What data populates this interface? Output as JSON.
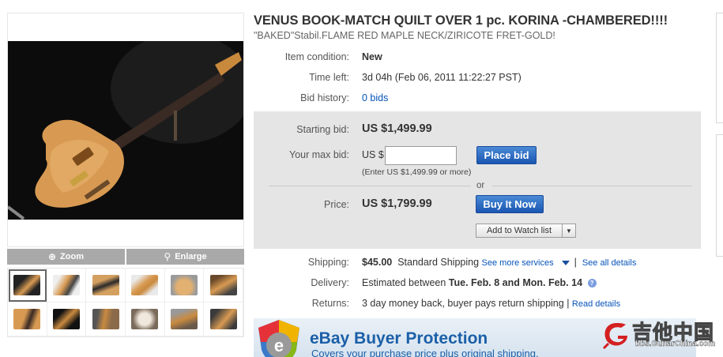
{
  "listing": {
    "title": "VENUS BOOK-MATCH QUILT OVER 1 pc. KORINA -CHAMBERED!!!!",
    "subtitle": "\"BAKED\"Stabil.FLAME RED MAPLE NECK/ZIRICOTE FRET-GOLD!"
  },
  "gallery": {
    "zoom_label": "Zoom",
    "enlarge_label": "Enlarge",
    "zoom_icon": "crosshair-icon",
    "enlarge_icon": "magnifier-icon",
    "thumbnail_count": 12
  },
  "details": {
    "condition_label": "Item condition:",
    "condition_value": "New",
    "time_left_label": "Time left:",
    "time_left_value": "3d 04h",
    "time_left_end": "(Feb 06, 2011 11:22:27 PST)",
    "bid_history_label": "Bid history:",
    "bid_history_value": "0 bids"
  },
  "bidding": {
    "starting_bid_label": "Starting bid:",
    "starting_bid_value": "US $1,499.99",
    "max_bid_label": "Your max bid:",
    "currency_prefix": "US $",
    "max_bid_value": "",
    "place_bid_label": "Place bid",
    "hint": "(Enter US $1,499.99 or more)",
    "or_label": "or",
    "price_label": "Price:",
    "price_value": "US $1,799.99",
    "buy_it_now_label": "Buy It Now",
    "watch_list_label": "Add to Watch list",
    "watch_dropdown_icon": "triangle-down-icon"
  },
  "shipping": {
    "shipping_label": "Shipping:",
    "shipping_cost": "$45.00",
    "shipping_method": "Standard Shipping",
    "more_services": "See more services",
    "separator": "|",
    "see_all": "See all details",
    "delivery_label": "Delivery:",
    "delivery_prefix": "Estimated between",
    "delivery_range": "Tue. Feb. 8 and Mon. Feb. 14",
    "returns_label": "Returns:",
    "returns_value": "3 day money back, buyer pays return shipping",
    "read_details": "Read details"
  },
  "protection": {
    "title": "eBay Buyer Protection",
    "subtitle": "Covers your purchase price plus original shipping."
  },
  "watermark": {
    "chinese": "吉他中国",
    "domain": "bbs.GuitarChina.com"
  },
  "colors": {
    "link": "#0654ba",
    "button_blue": "#1a56b2",
    "bid_box_bg": "#e5e5e5",
    "protection_blue": "#1b5fa8"
  }
}
